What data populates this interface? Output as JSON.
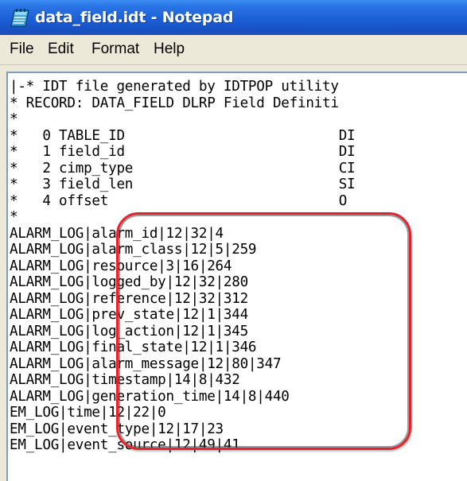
{
  "window": {
    "title": "data_field.idt - Notepad",
    "icon": "notepad-icon"
  },
  "menu": {
    "items": [
      "File",
      "Edit",
      "Format",
      "Help"
    ]
  },
  "document": {
    "lines": [
      "|-* IDT file generated by IDTPOP utility",
      "* RECORD: DATA_FIELD DLRP Field Definiti",
      "*",
      "*   0 TABLE_ID                          DI",
      "*   1 field_id                          DI",
      "*   2 cimp_type                         CI",
      "*   3 field_len                         SI",
      "*   4 offset                            O",
      "*",
      "ALARM_LOG|alarm_id|12|32|4",
      "ALARM_LOG|alarm_class|12|5|259",
      "ALARM_LOG|resource|3|16|264",
      "ALARM_LOG|logged_by|12|32|280",
      "ALARM_LOG|reference|12|32|312",
      "ALARM_LOG|prev_state|12|1|344",
      "ALARM_LOG|log_action|12|1|345",
      "ALARM_LOG|final_state|12|1|346",
      "ALARM_LOG|alarm_message|12|80|347",
      "ALARM_LOG|timestamp|14|8|432",
      "ALARM_LOG|generation_time|14|8|440",
      "EM_LOG|time|12|22|0",
      "EM_LOG|event_type|12|17|23",
      "EM_LOG|event_source|12|49|41"
    ]
  },
  "annotation": {
    "color": "#e3242b"
  }
}
